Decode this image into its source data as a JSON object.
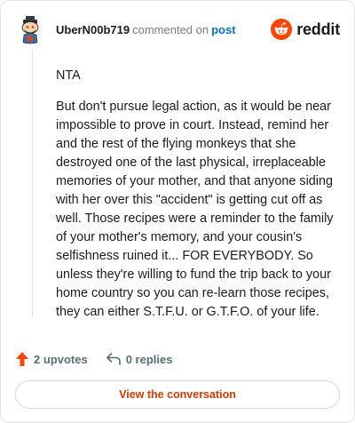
{
  "header": {
    "username": "UberN00b719",
    "action_text": "commented on",
    "post_link": "post",
    "brand": "reddit",
    "brand_color": "#FF4500"
  },
  "comment": {
    "paragraphs": [
      "NTA",
      "But don't pursue legal action, as it would be near impossible to prove in court. Instead, remind her and the rest of the flying monkeys that she destroyed one of the last physical, irreplaceable memories of your mother, and that anyone siding with her over this \"accident\" is getting cut off as well. Those recipes were a reminder to the family of your mother's memory, and your cousin's selfishness ruined it... FOR EVERYBODY. So unless they're willing to fund the trip back to your home country so you can re-learn those recipes, they can either S.T.F.U. or G.T.F.O. of your life."
    ]
  },
  "actions": {
    "upvotes": "2 upvotes",
    "replies": "0 replies",
    "upvote_icon": "upvote-arrow-icon",
    "reply_icon": "reply-arrow-icon",
    "upvote_color": "#FF4500"
  },
  "cta": {
    "label": "View the conversation",
    "color": "#D93A00"
  }
}
